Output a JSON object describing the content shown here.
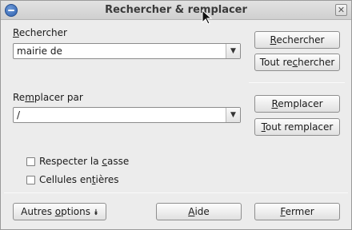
{
  "window": {
    "title": "Rechercher & remplacer"
  },
  "search": {
    "label_prefix": "",
    "label_access": "R",
    "label_rest": "echercher",
    "value": "mairie de"
  },
  "replace": {
    "label_prefix": "Re",
    "label_access": "m",
    "label_rest": "placer par",
    "value": "/"
  },
  "buttons": {
    "search_access": "R",
    "search_rest": "echercher",
    "search_all_prefix": "Tout re",
    "search_all_access": "c",
    "search_all_rest": "hercher",
    "replace_access": "R",
    "replace_rest": "emplacer",
    "replace_all_access": "T",
    "replace_all_rest": "out remplacer"
  },
  "options": {
    "match_case_prefix": "Respecter la ",
    "match_case_access": "c",
    "match_case_rest": "asse",
    "whole_cells_prefix": "Cellules en",
    "whole_cells_access": "t",
    "whole_cells_rest": "ières"
  },
  "footer": {
    "more_options_prefix": "Autres ",
    "more_options_access": "o",
    "more_options_rest": "ptions",
    "help_access": "A",
    "help_rest": "ide",
    "close_access": "F",
    "close_rest": "ermer"
  },
  "icons": {
    "app": "app-icon",
    "close": "close-icon",
    "dropdown": "chevron-down-icon",
    "more": "double-chevron-down-icon",
    "cursor": "mouse-pointer-icon"
  }
}
